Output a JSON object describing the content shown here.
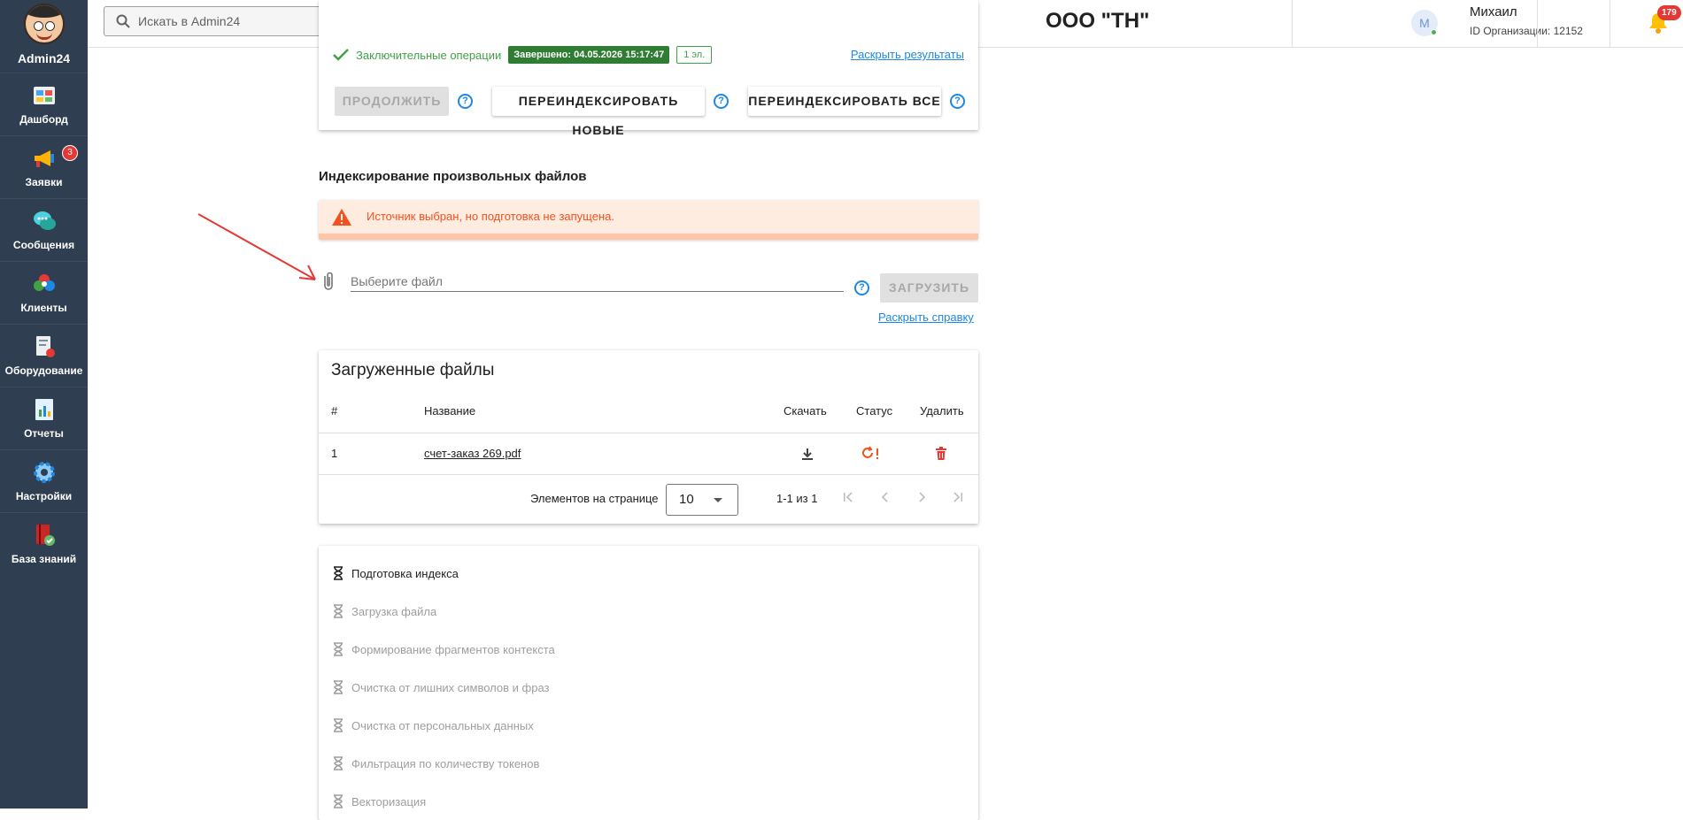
{
  "sidebar": {
    "logo_text": "Admin24",
    "items": [
      {
        "label": "Дашборд",
        "icon": "dashboard-icon"
      },
      {
        "label": "Заявки",
        "icon": "megaphone-icon",
        "badge": "3"
      },
      {
        "label": "Сообщения",
        "icon": "chat-bubbles-icon"
      },
      {
        "label": "Клиенты",
        "icon": "clients-icon"
      },
      {
        "label": "Оборудование",
        "icon": "equipment-icon"
      },
      {
        "label": "Отчеты",
        "icon": "reports-icon"
      },
      {
        "label": "Настройки",
        "icon": "gear-icon"
      },
      {
        "label": "База знаний",
        "icon": "knowledge-base-icon"
      }
    ]
  },
  "topbar": {
    "search_placeholder": "Искать в Admin24",
    "org_title": "ООО \"ТН\"",
    "avatar_letter": "М",
    "user_name": "Михаил",
    "org_id": "ID Организации: 12152",
    "notifications_count": "179",
    "help_glyph": "?"
  },
  "top_card": {
    "final_ops_label": "Заключительные операции",
    "completed_badge": "Завершено: 04.05.2026 15:17:47",
    "count_badge": "1 эл.",
    "expand_results": "Раскрыть результаты",
    "continue_btn": "ПРОДОЛЖИТЬ",
    "reindex_new_btn": "ПЕРЕИНДЕКСИРОВАТЬ НОВЫЕ",
    "reindex_all_btn": "ПЕРЕИНДЕКСИРОВАТЬ ВСЕ"
  },
  "custom_files": {
    "title": "Индексирование произвольных файлов",
    "alert": "Источник выбран, но подготовка не запущена.",
    "file_placeholder": "Выберите файл",
    "upload_btn": "ЗАГРУЗИТЬ",
    "expand_help": "Раскрыть справку"
  },
  "uploaded_files": {
    "title": "Загруженные файлы",
    "columns": [
      "#",
      "Название",
      "Скачать",
      "Статус",
      "Удалить"
    ],
    "rows": [
      {
        "num": "1",
        "name": "счет-заказ 269.pdf",
        "status": "processing-warning"
      }
    ],
    "page_size_label": "Элементов на странице",
    "page_size": "10",
    "range": "1-1 из 1"
  },
  "steps": [
    {
      "label": "Подготовка индекса",
      "state": "active"
    },
    {
      "label": "Загрузка файла",
      "state": "pending"
    },
    {
      "label": "Формирование фрагментов контекста",
      "state": "pending"
    },
    {
      "label": "Очистка от лишних символов и фраз",
      "state": "pending"
    },
    {
      "label": "Очистка от персональных данных",
      "state": "pending"
    },
    {
      "label": "Фильтрация по количеству токенов",
      "state": "pending"
    },
    {
      "label": "Векторизация",
      "state": "pending"
    }
  ],
  "colors": {
    "sidebar_bg": "#2f3e50",
    "accent_blue": "#1e88e5",
    "success_green": "#2e7d32",
    "warning_orange": "#f4511e",
    "danger_red": "#e53935"
  }
}
